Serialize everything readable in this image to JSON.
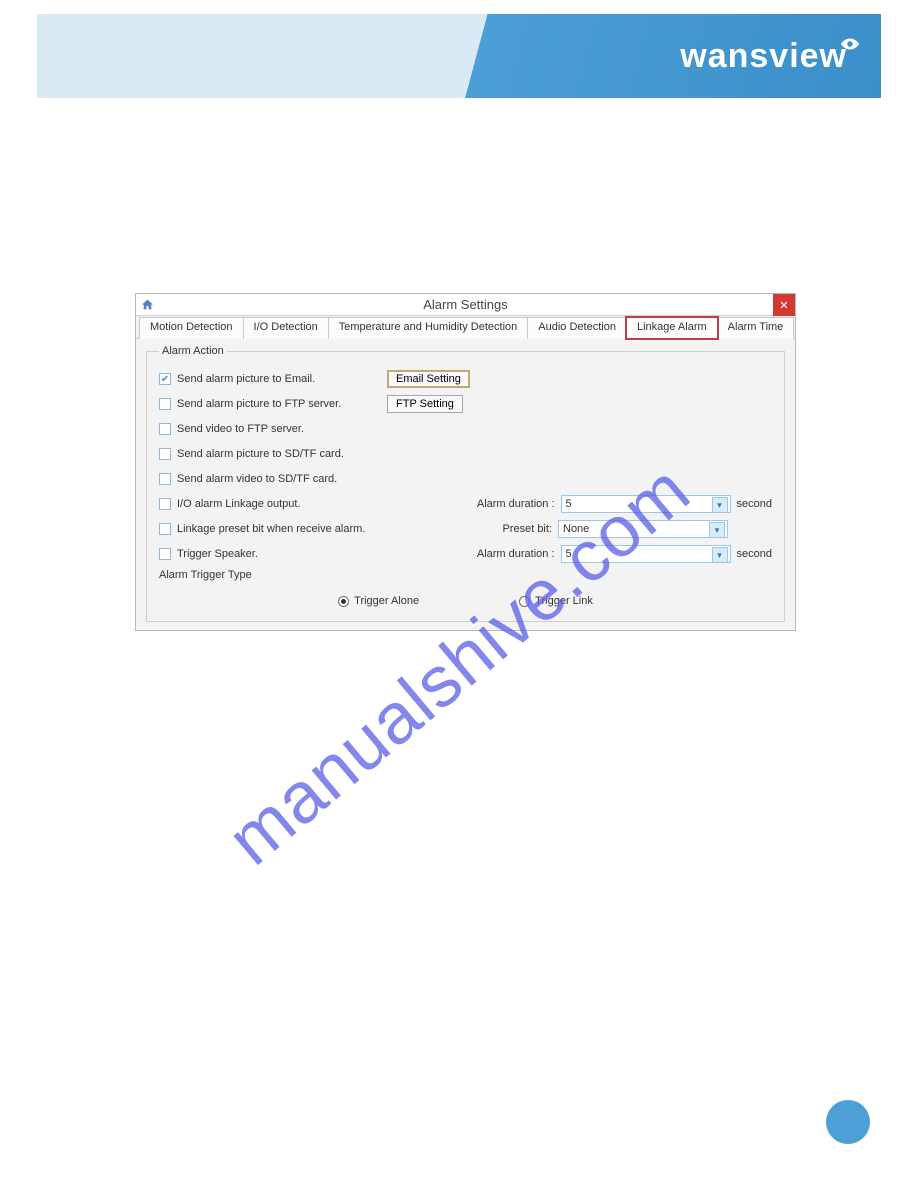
{
  "banner": {
    "brand": "wansview"
  },
  "dialog": {
    "title": "Alarm Settings",
    "tabs": [
      "Motion Detection",
      "I/O Detection",
      "Temperature and Humidity Detection",
      "Audio Detection",
      "Linkage Alarm",
      "Alarm Time"
    ],
    "active_tab_index": 4,
    "fieldset_label": "Alarm Action",
    "rows": {
      "email": {
        "label": "Send alarm picture to Email.",
        "button": "Email Setting",
        "checked": true
      },
      "ftp_pic": {
        "label": "Send alarm picture to FTP server.",
        "button": "FTP Setting",
        "checked": false
      },
      "ftp_video": {
        "label": "Send video to FTP server.",
        "checked": false
      },
      "sd_pic": {
        "label": "Send alarm picture to SD/TF card.",
        "checked": false
      },
      "sd_video": {
        "label": "Send alarm video to SD/TF card.",
        "checked": false
      },
      "io_linkage": {
        "label": "I/O alarm Linkage output.",
        "checked": false,
        "right_label": "Alarm duration :",
        "value": "5",
        "unit": "second"
      },
      "preset": {
        "label": "Linkage preset bit when receive alarm.",
        "checked": false,
        "right_label": "Preset bit:",
        "value": "None"
      },
      "speaker": {
        "label": "Trigger Speaker.",
        "checked": false,
        "right_label": "Alarm duration :",
        "value": "5",
        "unit": "second"
      }
    },
    "trigger_type_label": "Alarm Trigger Type",
    "radios": {
      "alone": "Trigger Alone",
      "link": "Trigger Link",
      "selected": "alone"
    }
  },
  "watermark": "manualshive.com"
}
